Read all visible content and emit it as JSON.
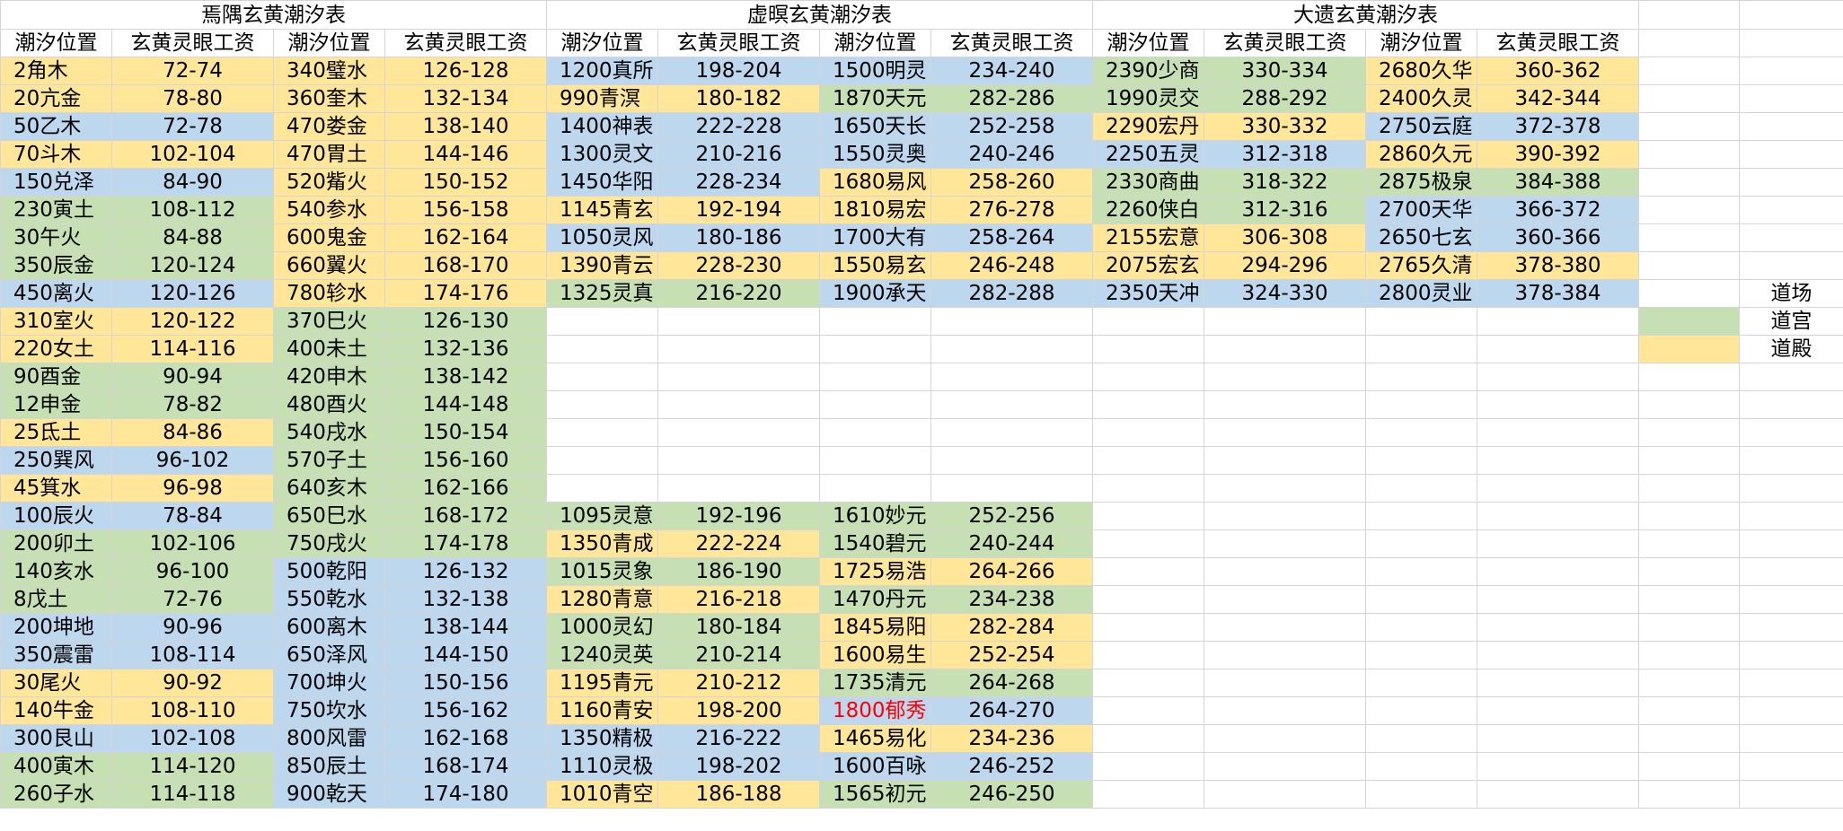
{
  "colors": {
    "blue": "#bdd7ee",
    "green": "#c6e0b4",
    "yellow": "#ffe699",
    "red_text": "#ff0000"
  },
  "titles": [
    "焉隅玄黄潮汐表",
    "虚暝玄黄潮汐表",
    "大遗玄黄潮汐表"
  ],
  "headers": [
    "潮汐位置",
    "玄黄灵眼工资",
    "潮汐位置",
    "玄黄灵眼工资",
    "潮汐位置",
    "玄黄灵眼工资",
    "潮汐位置",
    "玄黄灵眼工资",
    "潮汐位置",
    "玄黄灵眼工资",
    "潮汐位置",
    "玄黄灵眼工资"
  ],
  "legend": [
    {
      "label": "道场",
      "color": ""
    },
    {
      "label": "道宫",
      "color": "green"
    },
    {
      "label": "道殿",
      "color": "yellow"
    }
  ],
  "rows": [
    [
      [
        "2角木",
        "yellow"
      ],
      [
        "72-74",
        "yellow"
      ],
      [
        "340璧水",
        "yellow"
      ],
      [
        "126-128",
        "yellow"
      ],
      [
        "1200真所",
        "blue"
      ],
      [
        "198-204",
        "blue"
      ],
      [
        "1500明灵",
        "blue"
      ],
      [
        "234-240",
        "blue"
      ],
      [
        "2390少商",
        "green"
      ],
      [
        "330-334",
        "green"
      ],
      [
        "2680久华",
        "yellow"
      ],
      [
        "360-362",
        "yellow"
      ]
    ],
    [
      [
        "20亢金",
        "yellow"
      ],
      [
        "78-80",
        "yellow"
      ],
      [
        "360奎木",
        "yellow"
      ],
      [
        "132-134",
        "yellow"
      ],
      [
        "990青溟",
        "yellow"
      ],
      [
        "180-182",
        "yellow"
      ],
      [
        "1870天元",
        "green"
      ],
      [
        "282-286",
        "green"
      ],
      [
        "1990灵交",
        "green"
      ],
      [
        "288-292",
        "green"
      ],
      [
        "2400久灵",
        "yellow"
      ],
      [
        "342-344",
        "yellow"
      ]
    ],
    [
      [
        "50乙木",
        "blue"
      ],
      [
        "72-78",
        "blue"
      ],
      [
        "470娄金",
        "yellow"
      ],
      [
        "138-140",
        "yellow"
      ],
      [
        "1400神表",
        "blue"
      ],
      [
        "222-228",
        "blue"
      ],
      [
        "1650天长",
        "blue"
      ],
      [
        "252-258",
        "blue"
      ],
      [
        "2290宏丹",
        "yellow"
      ],
      [
        "330-332",
        "yellow"
      ],
      [
        "2750云庭",
        "blue"
      ],
      [
        "372-378",
        "blue"
      ]
    ],
    [
      [
        "70斗木",
        "yellow"
      ],
      [
        "102-104",
        "yellow"
      ],
      [
        "470胃土",
        "yellow"
      ],
      [
        "144-146",
        "yellow"
      ],
      [
        "1300灵文",
        "blue"
      ],
      [
        "210-216",
        "blue"
      ],
      [
        "1550灵奥",
        "blue"
      ],
      [
        "240-246",
        "blue"
      ],
      [
        "2250五灵",
        "blue"
      ],
      [
        "312-318",
        "blue"
      ],
      [
        "2860久元",
        "yellow"
      ],
      [
        "390-392",
        "yellow"
      ]
    ],
    [
      [
        "150兑泽",
        "blue"
      ],
      [
        "84-90",
        "blue"
      ],
      [
        "520觜火",
        "yellow"
      ],
      [
        "150-152",
        "yellow"
      ],
      [
        "1450华阳",
        "blue"
      ],
      [
        "228-234",
        "blue"
      ],
      [
        "1680易风",
        "yellow"
      ],
      [
        "258-260",
        "yellow"
      ],
      [
        "2330商曲",
        "green"
      ],
      [
        "318-322",
        "green"
      ],
      [
        "2875极泉",
        "green"
      ],
      [
        "384-388",
        "green"
      ]
    ],
    [
      [
        "230寅土",
        "green"
      ],
      [
        "108-112",
        "green"
      ],
      [
        "540参水",
        "yellow"
      ],
      [
        "156-158",
        "yellow"
      ],
      [
        "1145青玄",
        "yellow"
      ],
      [
        "192-194",
        "yellow"
      ],
      [
        "1810易宏",
        "yellow"
      ],
      [
        "276-278",
        "yellow"
      ],
      [
        "2260侠白",
        "green"
      ],
      [
        "312-316",
        "green"
      ],
      [
        "2700天华",
        "blue"
      ],
      [
        "366-372",
        "blue"
      ]
    ],
    [
      [
        "30午火",
        "green"
      ],
      [
        "84-88",
        "green"
      ],
      [
        "600鬼金",
        "yellow"
      ],
      [
        "162-164",
        "yellow"
      ],
      [
        "1050灵风",
        "blue"
      ],
      [
        "180-186",
        "blue"
      ],
      [
        "1700大有",
        "blue"
      ],
      [
        "258-264",
        "blue"
      ],
      [
        "2155宏意",
        "yellow"
      ],
      [
        "306-308",
        "yellow"
      ],
      [
        "2650七玄",
        "blue"
      ],
      [
        "360-366",
        "blue"
      ]
    ],
    [
      [
        "350辰金",
        "green"
      ],
      [
        "120-124",
        "green"
      ],
      [
        "660翼火",
        "yellow"
      ],
      [
        "168-170",
        "yellow"
      ],
      [
        "1390青云",
        "yellow"
      ],
      [
        "228-230",
        "yellow"
      ],
      [
        "1550易玄",
        "yellow"
      ],
      [
        "246-248",
        "yellow"
      ],
      [
        "2075宏玄",
        "yellow"
      ],
      [
        "294-296",
        "yellow"
      ],
      [
        "2765久清",
        "yellow"
      ],
      [
        "378-380",
        "yellow"
      ]
    ],
    [
      [
        "450离火",
        "blue"
      ],
      [
        "120-126",
        "blue"
      ],
      [
        "780轸水",
        "yellow"
      ],
      [
        "174-176",
        "yellow"
      ],
      [
        "1325灵真",
        "green"
      ],
      [
        "216-220",
        "green"
      ],
      [
        "1900承天",
        "blue"
      ],
      [
        "282-288",
        "blue"
      ],
      [
        "2350天冲",
        "blue"
      ],
      [
        "324-330",
        "blue"
      ],
      [
        "2800灵业",
        "blue"
      ],
      [
        "378-384",
        "blue"
      ]
    ],
    [
      [
        "310室火",
        "yellow"
      ],
      [
        "120-122",
        "yellow"
      ],
      [
        "370巳火",
        "green"
      ],
      [
        "126-130",
        "green"
      ],
      [
        "",
        ""
      ],
      [
        "",
        ""
      ],
      [
        "",
        ""
      ],
      [
        "",
        ""
      ],
      [
        "",
        ""
      ],
      [
        "",
        ""
      ],
      [
        "",
        ""
      ],
      [
        "",
        ""
      ]
    ],
    [
      [
        "220女土",
        "yellow"
      ],
      [
        "114-116",
        "yellow"
      ],
      [
        "400未土",
        "green"
      ],
      [
        "132-136",
        "green"
      ],
      [
        "",
        ""
      ],
      [
        "",
        ""
      ],
      [
        "",
        ""
      ],
      [
        "",
        ""
      ],
      [
        "",
        ""
      ],
      [
        "",
        ""
      ],
      [
        "",
        ""
      ],
      [
        "",
        ""
      ]
    ],
    [
      [
        "90酉金",
        "green"
      ],
      [
        "90-94",
        "green"
      ],
      [
        "420申木",
        "green"
      ],
      [
        "138-142",
        "green"
      ],
      [
        "",
        ""
      ],
      [
        "",
        ""
      ],
      [
        "",
        ""
      ],
      [
        "",
        ""
      ],
      [
        "",
        ""
      ],
      [
        "",
        ""
      ],
      [
        "",
        ""
      ],
      [
        "",
        ""
      ]
    ],
    [
      [
        "12申金",
        "green"
      ],
      [
        "78-82",
        "green"
      ],
      [
        "480酉火",
        "green"
      ],
      [
        "144-148",
        "green"
      ],
      [
        "",
        ""
      ],
      [
        "",
        ""
      ],
      [
        "",
        ""
      ],
      [
        "",
        ""
      ],
      [
        "",
        ""
      ],
      [
        "",
        ""
      ],
      [
        "",
        ""
      ],
      [
        "",
        ""
      ]
    ],
    [
      [
        "25氐土",
        "yellow"
      ],
      [
        "84-86",
        "yellow"
      ],
      [
        "540戌水",
        "green"
      ],
      [
        "150-154",
        "green"
      ],
      [
        "",
        ""
      ],
      [
        "",
        ""
      ],
      [
        "",
        ""
      ],
      [
        "",
        ""
      ],
      [
        "",
        ""
      ],
      [
        "",
        ""
      ],
      [
        "",
        ""
      ],
      [
        "",
        ""
      ]
    ],
    [
      [
        "250巽风",
        "blue"
      ],
      [
        "96-102",
        "blue"
      ],
      [
        "570子土",
        "green"
      ],
      [
        "156-160",
        "green"
      ],
      [
        "",
        ""
      ],
      [
        "",
        ""
      ],
      [
        "",
        ""
      ],
      [
        "",
        ""
      ],
      [
        "",
        ""
      ],
      [
        "",
        ""
      ],
      [
        "",
        ""
      ],
      [
        "",
        ""
      ]
    ],
    [
      [
        "45箕水",
        "yellow"
      ],
      [
        "96-98",
        "yellow"
      ],
      [
        "640亥木",
        "green"
      ],
      [
        "162-166",
        "green"
      ],
      [
        "",
        ""
      ],
      [
        "",
        ""
      ],
      [
        "",
        ""
      ],
      [
        "",
        ""
      ],
      [
        "",
        ""
      ],
      [
        "",
        ""
      ],
      [
        "",
        ""
      ],
      [
        "",
        ""
      ]
    ],
    [
      [
        "100辰火",
        "blue"
      ],
      [
        "78-84",
        "blue"
      ],
      [
        "650巳水",
        "green"
      ],
      [
        "168-172",
        "green"
      ],
      [
        "1095灵意",
        "green"
      ],
      [
        "192-196",
        "green"
      ],
      [
        "1610妙元",
        "green"
      ],
      [
        "252-256",
        "green"
      ],
      [
        "",
        ""
      ],
      [
        "",
        ""
      ],
      [
        "",
        ""
      ],
      [
        "",
        ""
      ]
    ],
    [
      [
        "200卯土",
        "green"
      ],
      [
        "102-106",
        "green"
      ],
      [
        "750戌火",
        "green"
      ],
      [
        "174-178",
        "green"
      ],
      [
        "1350青成",
        "yellow"
      ],
      [
        "222-224",
        "yellow"
      ],
      [
        "1540碧元",
        "green"
      ],
      [
        "240-244",
        "green"
      ],
      [
        "",
        ""
      ],
      [
        "",
        ""
      ],
      [
        "",
        ""
      ],
      [
        "",
        ""
      ]
    ],
    [
      [
        "140亥水",
        "green"
      ],
      [
        "96-100",
        "green"
      ],
      [
        "500乾阳",
        "blue"
      ],
      [
        "126-132",
        "blue"
      ],
      [
        "1015灵象",
        "green"
      ],
      [
        "186-190",
        "green"
      ],
      [
        "1725易浩",
        "yellow"
      ],
      [
        "264-266",
        "yellow"
      ],
      [
        "",
        ""
      ],
      [
        "",
        ""
      ],
      [
        "",
        ""
      ],
      [
        "",
        ""
      ]
    ],
    [
      [
        "8戊土",
        "green"
      ],
      [
        "72-76",
        "green"
      ],
      [
        "550乾水",
        "blue"
      ],
      [
        "132-138",
        "blue"
      ],
      [
        "1280青意",
        "yellow"
      ],
      [
        "216-218",
        "yellow"
      ],
      [
        "1470丹元",
        "green"
      ],
      [
        "234-238",
        "green"
      ],
      [
        "",
        ""
      ],
      [
        "",
        ""
      ],
      [
        "",
        ""
      ],
      [
        "",
        ""
      ]
    ],
    [
      [
        "200坤地",
        "blue"
      ],
      [
        "90-96",
        "blue"
      ],
      [
        "600离木",
        "blue"
      ],
      [
        "138-144",
        "blue"
      ],
      [
        "1000灵幻",
        "green"
      ],
      [
        "180-184",
        "green"
      ],
      [
        "1845易阳",
        "yellow"
      ],
      [
        "282-284",
        "yellow"
      ],
      [
        "",
        ""
      ],
      [
        "",
        ""
      ],
      [
        "",
        ""
      ],
      [
        "",
        ""
      ]
    ],
    [
      [
        "350震雷",
        "blue"
      ],
      [
        "108-114",
        "blue"
      ],
      [
        "650泽风",
        "blue"
      ],
      [
        "144-150",
        "blue"
      ],
      [
        "1240灵英",
        "green"
      ],
      [
        "210-214",
        "green"
      ],
      [
        "1600易生",
        "yellow"
      ],
      [
        "252-254",
        "yellow"
      ],
      [
        "",
        ""
      ],
      [
        "",
        ""
      ],
      [
        "",
        ""
      ],
      [
        "",
        ""
      ]
    ],
    [
      [
        "30尾火",
        "yellow"
      ],
      [
        "90-92",
        "yellow"
      ],
      [
        "700坤火",
        "blue"
      ],
      [
        "150-156",
        "blue"
      ],
      [
        "1195青元",
        "yellow"
      ],
      [
        "210-212",
        "yellow"
      ],
      [
        "1735清元",
        "green"
      ],
      [
        "264-268",
        "green"
      ],
      [
        "",
        ""
      ],
      [
        "",
        ""
      ],
      [
        "",
        ""
      ],
      [
        "",
        ""
      ]
    ],
    [
      [
        "140牛金",
        "yellow"
      ],
      [
        "108-110",
        "yellow"
      ],
      [
        "750坎水",
        "blue"
      ],
      [
        "156-162",
        "blue"
      ],
      [
        "1160青安",
        "yellow"
      ],
      [
        "198-200",
        "yellow"
      ],
      [
        "1800郁秀",
        "blue-red"
      ],
      [
        "264-270",
        "blue"
      ],
      [
        "",
        ""
      ],
      [
        "",
        ""
      ],
      [
        "",
        ""
      ],
      [
        "",
        ""
      ]
    ],
    [
      [
        "300艮山",
        "blue"
      ],
      [
        "102-108",
        "blue"
      ],
      [
        "800风雷",
        "blue"
      ],
      [
        "162-168",
        "blue"
      ],
      [
        "1350精极",
        "blue"
      ],
      [
        "216-222",
        "blue"
      ],
      [
        "1465易化",
        "yellow"
      ],
      [
        "234-236",
        "yellow"
      ],
      [
        "",
        ""
      ],
      [
        "",
        ""
      ],
      [
        "",
        ""
      ],
      [
        "",
        ""
      ]
    ],
    [
      [
        "400寅木",
        "green"
      ],
      [
        "114-120",
        "green"
      ],
      [
        "850辰土",
        "blue"
      ],
      [
        "168-174",
        "blue"
      ],
      [
        "1110灵极",
        "blue"
      ],
      [
        "198-202",
        "blue"
      ],
      [
        "1600百咏",
        "blue"
      ],
      [
        "246-252",
        "blue"
      ],
      [
        "",
        ""
      ],
      [
        "",
        ""
      ],
      [
        "",
        ""
      ],
      [
        "",
        ""
      ]
    ],
    [
      [
        "260子水",
        "green"
      ],
      [
        "114-118",
        "green"
      ],
      [
        "900乾天",
        "blue"
      ],
      [
        "174-180",
        "blue"
      ],
      [
        "1010青空",
        "yellow"
      ],
      [
        "186-188",
        "yellow"
      ],
      [
        "1565初元",
        "green"
      ],
      [
        "246-250",
        "green"
      ],
      [
        "",
        ""
      ],
      [
        "",
        ""
      ],
      [
        "",
        ""
      ],
      [
        "",
        ""
      ]
    ]
  ]
}
